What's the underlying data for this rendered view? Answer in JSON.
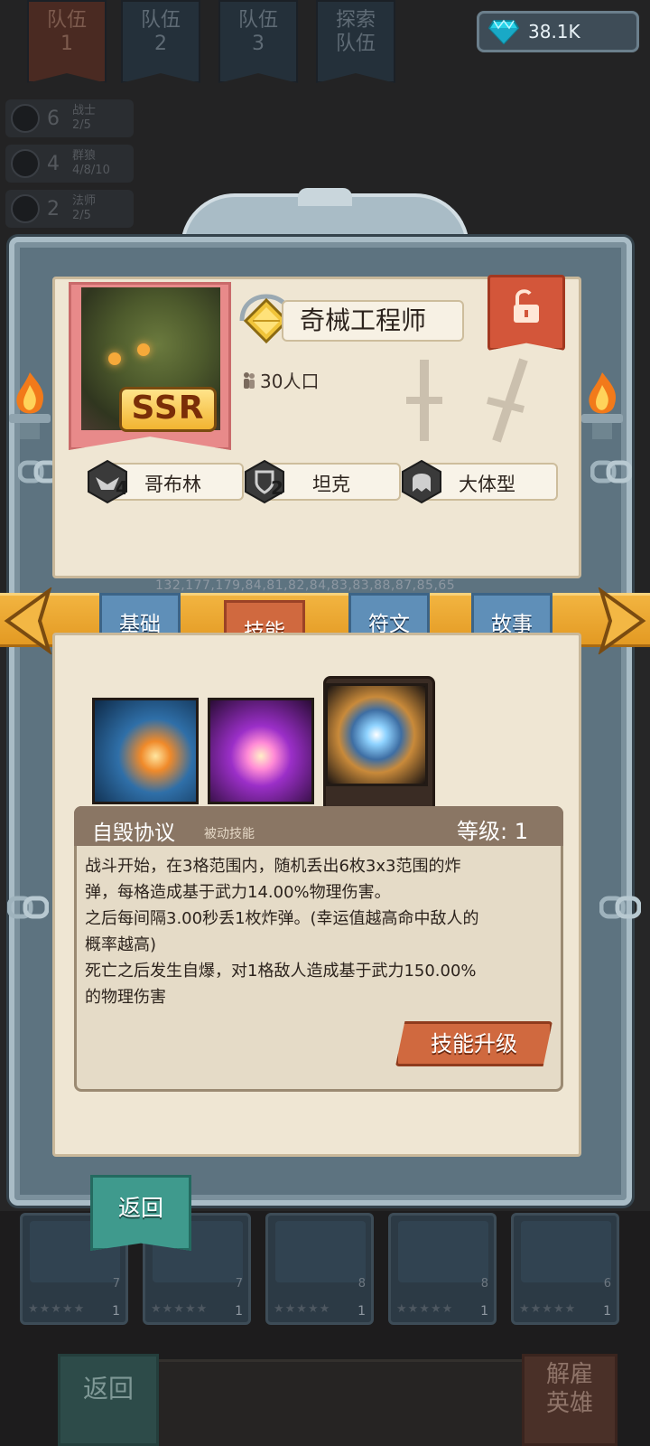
{
  "top_tabs": [
    {
      "line1": "队伍",
      "line2": "1"
    },
    {
      "line1": "队伍",
      "line2": "2"
    },
    {
      "line1": "队伍",
      "line2": "3"
    },
    {
      "line1": "探索",
      "line2": "队伍"
    }
  ],
  "gems": "38.1K",
  "factions": [
    {
      "count": "6",
      "name": "战士",
      "progress": "2/5"
    },
    {
      "count": "4",
      "name": "群狼",
      "progress": "4/8/10"
    },
    {
      "count": "2",
      "name": "法师",
      "progress": "2/5"
    }
  ],
  "hero": {
    "name": "奇械工程师",
    "rarity": "SSR",
    "population": "30人口",
    "tags": [
      {
        "num": "4",
        "label": "哥布林"
      },
      {
        "num": "2",
        "label": "坦克"
      },
      {
        "num": "",
        "label": "大体型"
      }
    ]
  },
  "stats_line": "132,177,179,84,81,82,84,83,83,88,87,85,65",
  "tabs": [
    "基础",
    "技能",
    "符文",
    "故事"
  ],
  "active_tab": "技能",
  "skill": {
    "name": "自毁协议",
    "type": "被动技能",
    "level": "等级: 1",
    "description": "战斗开始，在3格范围内，随机丢出6枚3x3范围的炸\n弹，每格造成基于武力14.00%物理伤害。\n之后每间隔3.00秒丢1枚炸弹。(幸运值越高命中敌人的\n概率越高)\n死亡之后发生自爆，对1格敌人造成基于武力150.00%\n的物理伤害",
    "upgrade_label": "技能升级"
  },
  "back_label": "返回",
  "footer": {
    "back_label": "返回",
    "fire_line1": "解雇",
    "fire_line2": "英雄"
  },
  "hero_cards": [
    {
      "pop": "7",
      "level": "1"
    },
    {
      "pop": "7",
      "level": "1"
    },
    {
      "pop": "8",
      "level": "1"
    },
    {
      "pop": "8",
      "level": "1"
    },
    {
      "pop": "6",
      "level": "1"
    }
  ],
  "colors": {
    "tab_blue": "#5f8fb8",
    "tab_active": "#d0693f",
    "ribbon": "#f2b440",
    "paper": "#efe6d3",
    "frame": "#a9bcc6",
    "back_button": "#3f9a8d"
  }
}
